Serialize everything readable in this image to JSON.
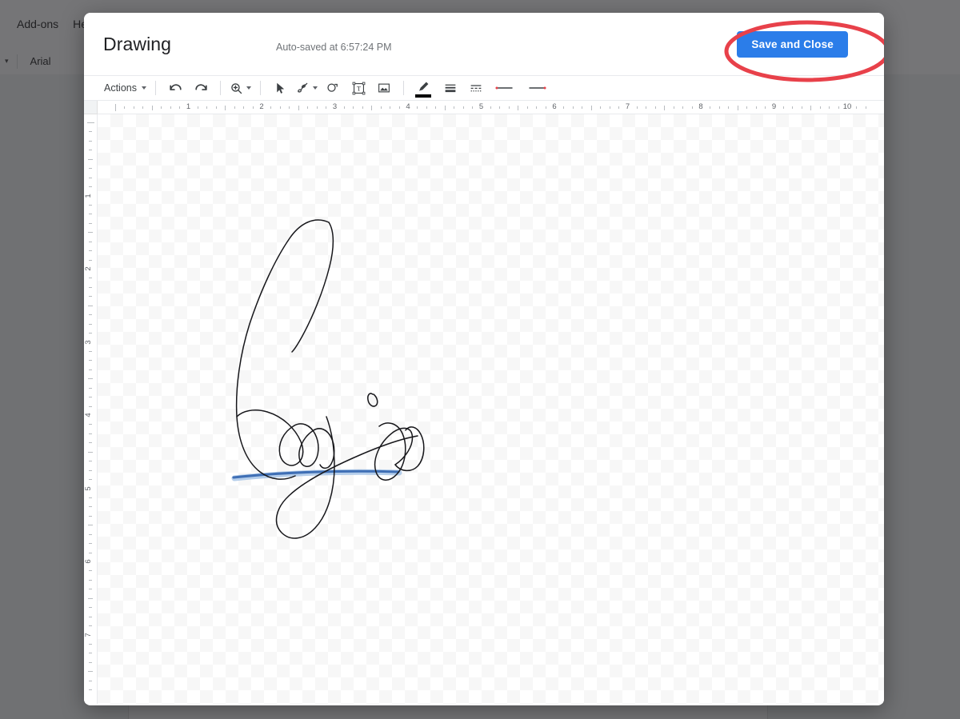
{
  "background": {
    "menus": [
      {
        "label": "Add-ons",
        "name": "menu-add-ons"
      },
      {
        "label": "Help",
        "name": "menu-help"
      }
    ],
    "toolbar": {
      "font_name": "Arial"
    }
  },
  "modal": {
    "title": "Drawing",
    "autosave_status": "Auto-saved at 6:57:24 PM",
    "save_button_label": "Save and Close",
    "save_button_color": "#2b7de9",
    "annotation_color": "#e8414a",
    "toolbar": {
      "actions_label": "Actions",
      "tools": [
        {
          "name": "undo-icon",
          "label": "Undo"
        },
        {
          "name": "redo-icon",
          "label": "Redo"
        },
        {
          "name": "zoom-icon",
          "label": "Zoom"
        },
        {
          "name": "select-arrow-icon",
          "label": "Select"
        },
        {
          "name": "scribble-line-icon",
          "label": "Line"
        },
        {
          "name": "shape-icon",
          "label": "Shape"
        },
        {
          "name": "text-box-icon",
          "label": "Text box"
        },
        {
          "name": "image-icon",
          "label": "Image"
        },
        {
          "name": "line-color-icon",
          "label": "Line color"
        },
        {
          "name": "line-weight-icon",
          "label": "Line weight"
        },
        {
          "name": "line-dash-icon",
          "label": "Line dash"
        },
        {
          "name": "line-start-icon",
          "label": "Line start"
        },
        {
          "name": "line-end-icon",
          "label": "Line end"
        }
      ],
      "line_color_value": "#000000"
    },
    "ruler": {
      "horizontal_labels": [
        "1",
        "2",
        "3",
        "4",
        "5",
        "6",
        "7",
        "8",
        "9",
        "10"
      ],
      "vertical_labels": [
        "1",
        "2",
        "3",
        "4",
        "5",
        "6",
        "7"
      ],
      "unit": "inches"
    },
    "canvas": {
      "content_description": "handwritten-signature",
      "ink_color": "#1c1c20",
      "underline_color": "#4a7ec0"
    }
  }
}
